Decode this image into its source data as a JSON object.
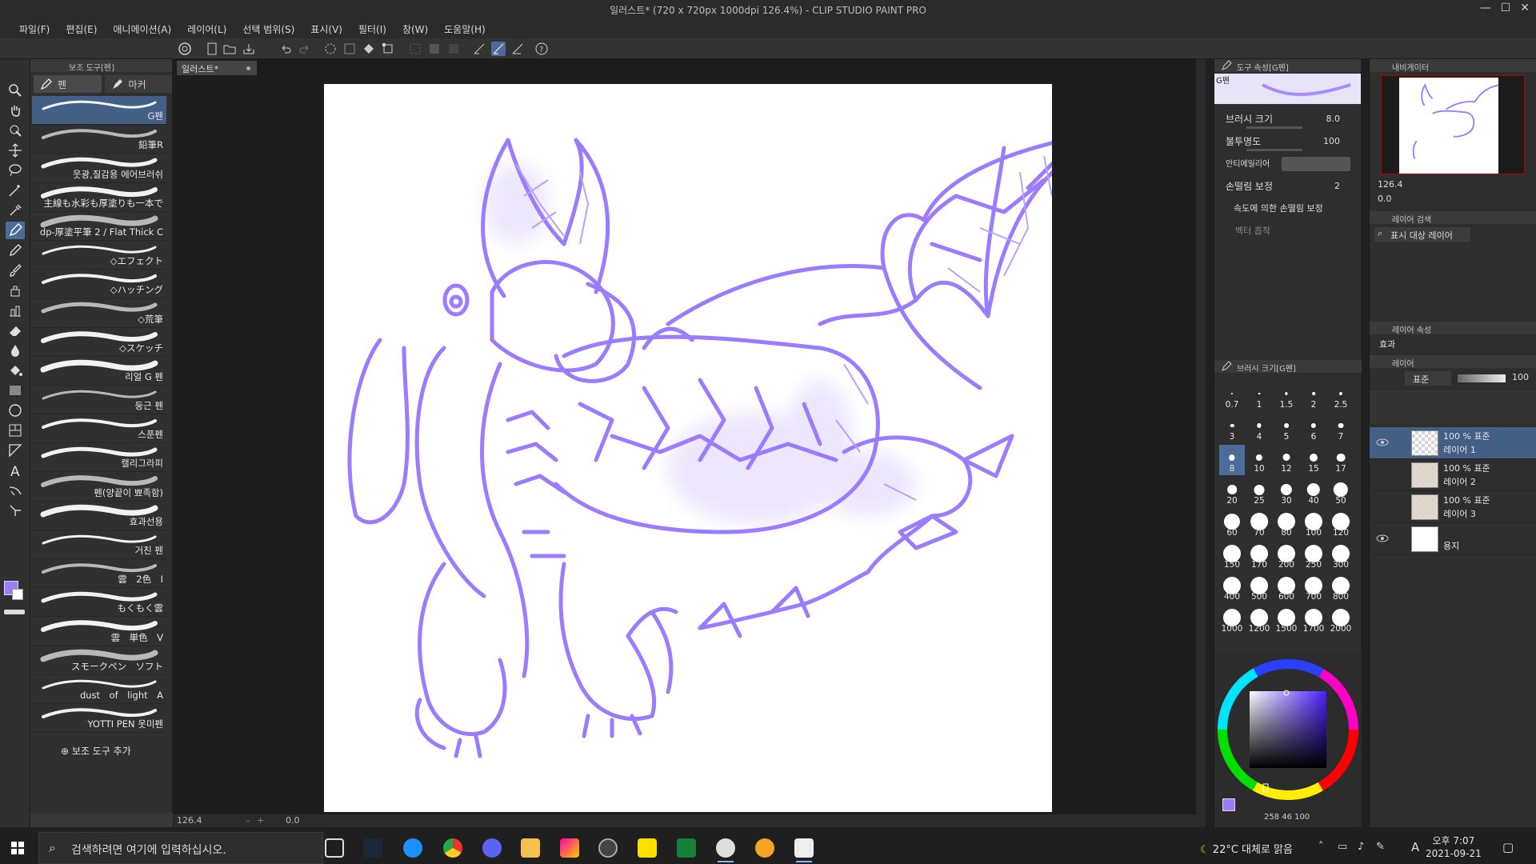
{
  "window": {
    "title": "일러스트* (720 x 720px 1000dpi 126.4%)  - CLIP STUDIO PAINT PRO",
    "controls": [
      "—",
      "☐",
      "✕"
    ]
  },
  "menu": [
    "파일(F)",
    "편집(E)",
    "애니메이션(A)",
    "레이어(L)",
    "선택 범위(S)",
    "표시(V)",
    "필터(I)",
    "창(W)",
    "도움말(H)"
  ],
  "subtool_panel": {
    "title": "보조 도구[펜]",
    "tabs": [
      "펜",
      "마커"
    ],
    "brushes": [
      "G펜",
      "鉛筆R",
      "웃광,질감용 에어브러쉬",
      "主線も水彩も厚塗りも一本で",
      "dp-厚塗平筆 2 / Flat Thick C",
      "◇エフェクト",
      "◇ハッチング",
      "◇荒筆",
      "◇スケッチ",
      "리얼 G 펜",
      "둥근 펜",
      "스푼펜",
      "캘리그라피",
      "펜(양끝이 뾰족함)",
      "효과선용",
      "거친 펜",
      "雲　2色　I",
      "もくもく雲",
      "雲　単色　V",
      "スモークペン　ソフト",
      "dust　of　light　A",
      "YOTTI PEN 옷미펜"
    ],
    "add_label": "보조 도구 추가"
  },
  "document": {
    "tab_label": "일러스트*",
    "zoom": "126.4",
    "rotation": "0.0"
  },
  "tool_property": {
    "title": "도구 속성[G펜]",
    "preview_label": "G펜",
    "brush_size_label": "브러시 크기",
    "brush_size_value": "8.0",
    "opacity_label": "불투명도",
    "opacity_value": "100",
    "antialias_label": "안티에일리어",
    "stabilization_label": "손떨림 보정",
    "stabilization_value": "2",
    "speed_stab_label": "속도에 의한 손떨림 보정",
    "vector_label": "벡터 흡착"
  },
  "brush_size_panel": {
    "title": "브러시 크기[G펜]",
    "sizes": [
      "0.7",
      "1",
      "1.5",
      "2",
      "2.5",
      "3",
      "4",
      "5",
      "6",
      "7",
      "8",
      "10",
      "12",
      "15",
      "17",
      "20",
      "25",
      "30",
      "40",
      "50",
      "60",
      "70",
      "80",
      "100",
      "120",
      "150",
      "170",
      "200",
      "250",
      "300",
      "400",
      "500",
      "600",
      "700",
      "800",
      "1000",
      "1200",
      "1500",
      "1700",
      "2000"
    ],
    "selected": "8"
  },
  "color_panel": {
    "readout": "258  46  100",
    "main_color": "#9b7bff",
    "sub_color": "#ffffff"
  },
  "navigator": {
    "title": "내비게이터",
    "zoom": "126.4",
    "rotation": "0.0"
  },
  "layer_search": {
    "title": "레이어 검색",
    "target": "표시 대상 레이어"
  },
  "layer_property": {
    "title": "레이어 속성",
    "effect_label": "효과"
  },
  "layers_panel": {
    "title": "레이어",
    "blend_mode": "표준",
    "opacity": "100",
    "layers": [
      {
        "mode": "100 % 표준",
        "name": "레이어 1"
      },
      {
        "mode": "100 % 표준",
        "name": "레이어 2"
      },
      {
        "mode": "100 % 표준",
        "name": "레이어 3"
      },
      {
        "mode": "",
        "name": "용지"
      }
    ]
  },
  "taskbar": {
    "search_placeholder": "검색하려면 여기에 입력하십시오.",
    "weather": "22°C  대체로 맑음",
    "time": "오후 7:07",
    "date": "2021-09-21",
    "ime": "A"
  },
  "colors": {
    "accent": "#4b6b98",
    "line_art": "#9b7bff"
  }
}
